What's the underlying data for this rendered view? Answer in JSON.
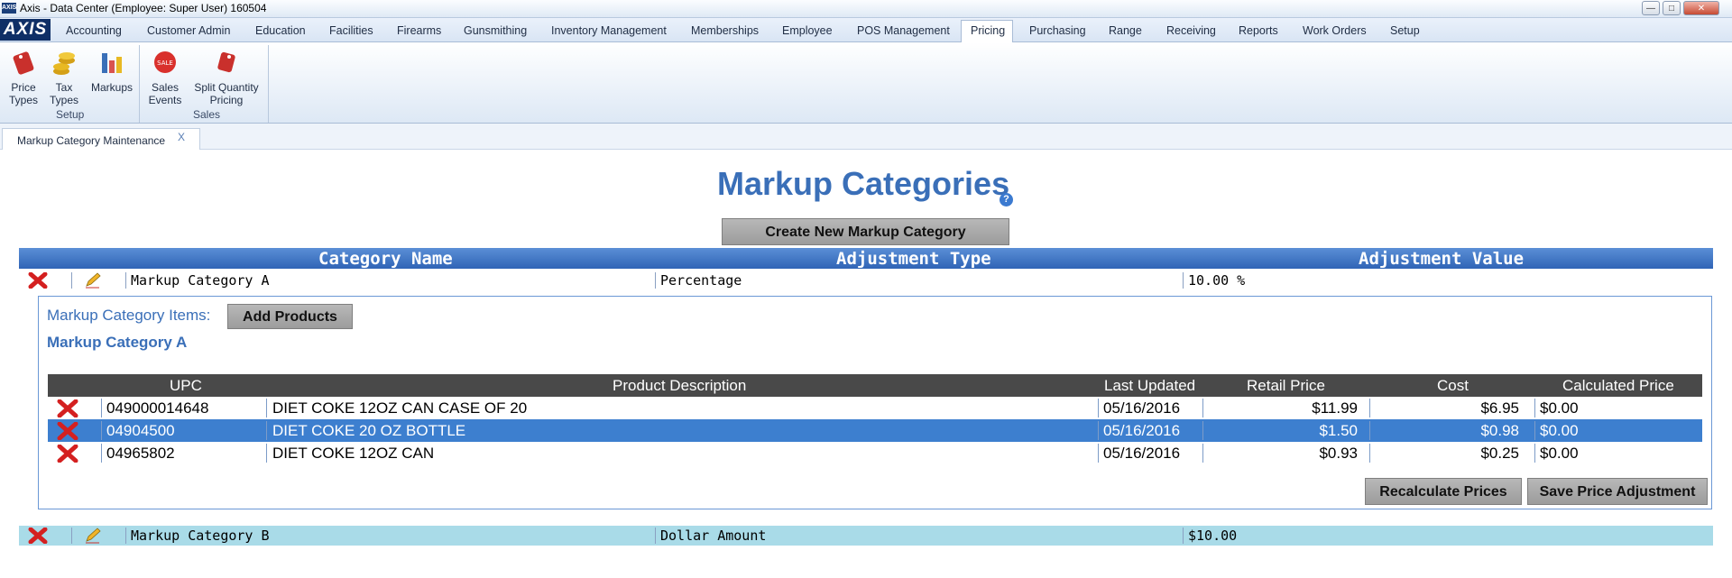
{
  "window": {
    "title": "Axis - Data Center  (Employee: Super User) 160504",
    "app_icon_text": "AXIS"
  },
  "logo_text": "AXIS",
  "menu": {
    "items": [
      "Accounting",
      "Customer Admin",
      "Education",
      "Facilities",
      "Firearms",
      "Gunsmithing",
      "Inventory Management",
      "Memberships",
      "Employee",
      "POS Management",
      "Pricing",
      "Purchasing",
      "Range",
      "Receiving",
      "Reports",
      "Work Orders",
      "Setup"
    ],
    "active": "Pricing"
  },
  "ribbon": {
    "setup": {
      "label": "Setup",
      "price_types": [
        "Price",
        "Types"
      ],
      "tax_types": [
        "Tax",
        "Types"
      ],
      "markups": "Markups"
    },
    "sales": {
      "label": "Sales",
      "sales_events": [
        "Sales",
        "Events"
      ],
      "split_quantity": [
        "Split Quantity",
        "Pricing"
      ]
    }
  },
  "doc_tab": {
    "label": "Markup Category Maintenance",
    "close": "X"
  },
  "page": {
    "title": "Markup Categories",
    "help": "?",
    "create_button": "Create New Markup Category",
    "columns": {
      "name": "Category Name",
      "type": "Adjustment Type",
      "value": "Adjustment Value"
    }
  },
  "categories": [
    {
      "name": "Markup Category A",
      "type": "Percentage",
      "value": "10.00 %"
    },
    {
      "name": "Markup Category B",
      "type": "Dollar Amount",
      "value": "$10.00"
    }
  ],
  "items_panel": {
    "label": "Markup Category Items:",
    "add_button": "Add Products",
    "category_name": "Markup Category A",
    "columns": {
      "upc": "UPC",
      "desc": "Product Description",
      "updated": "Last Updated",
      "retail": "Retail Price",
      "cost": "Cost",
      "calc": "Calculated Price"
    },
    "rows": [
      {
        "upc": "049000014648",
        "desc": "DIET COKE 12OZ CAN CASE OF 20",
        "updated": "05/16/2016",
        "retail": "$11.99",
        "cost": "$6.95",
        "calc": "$0.00"
      },
      {
        "upc": "04904500",
        "desc": "DIET COKE 20 OZ BOTTLE",
        "updated": "05/16/2016",
        "retail": "$1.50",
        "cost": "$0.98",
        "calc": "$0.00"
      },
      {
        "upc": "04965802",
        "desc": "DIET COKE 12OZ CAN",
        "updated": "05/16/2016",
        "retail": "$0.93",
        "cost": "$0.25",
        "calc": "$0.00"
      }
    ],
    "recalc_button": "Recalculate Prices",
    "save_button": "Save Price Adjustment"
  },
  "colors": {
    "accent": "#3a6fb8",
    "header_blue": "#2f64b6",
    "selected_row": "#3d7fcf",
    "category_b_row": "#a9dbe8"
  }
}
